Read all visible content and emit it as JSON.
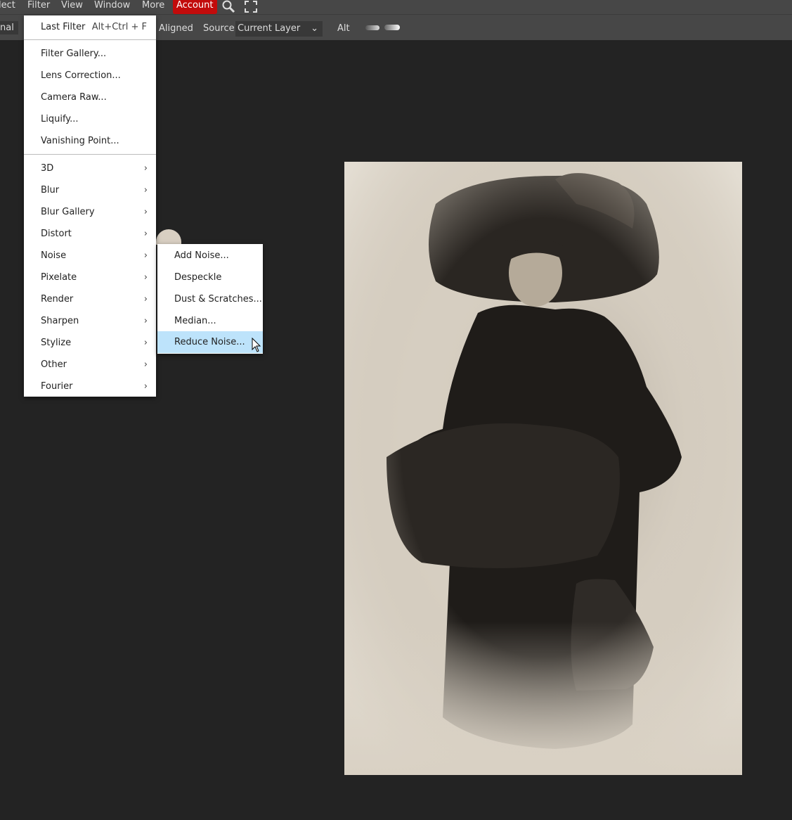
{
  "menubar": {
    "items": [
      "lect",
      "Filter",
      "View",
      "Window",
      "More"
    ],
    "account": "Account"
  },
  "options": {
    "mode": "nal",
    "aligned": "Aligned",
    "source_label": "Source:",
    "source_value": "Current Layer",
    "alt": "Alt"
  },
  "filter_menu": {
    "last_filter": "Last Filter",
    "last_filter_shortcut": "Alt+Ctrl + F",
    "items1": [
      "Filter Gallery...",
      "Lens Correction...",
      "Camera Raw...",
      "Liquify...",
      "Vanishing Point..."
    ],
    "submenus": [
      "3D",
      "Blur",
      "Blur Gallery",
      "Distort",
      "Noise",
      "Pixelate",
      "Render",
      "Sharpen",
      "Stylize",
      "Other",
      "Fourier"
    ]
  },
  "noise_menu": {
    "items": [
      "Add Noise...",
      "Despeckle",
      "Dust & Scratches...",
      "Median...",
      "Reduce Noise..."
    ],
    "highlighted": "Reduce Noise..."
  }
}
